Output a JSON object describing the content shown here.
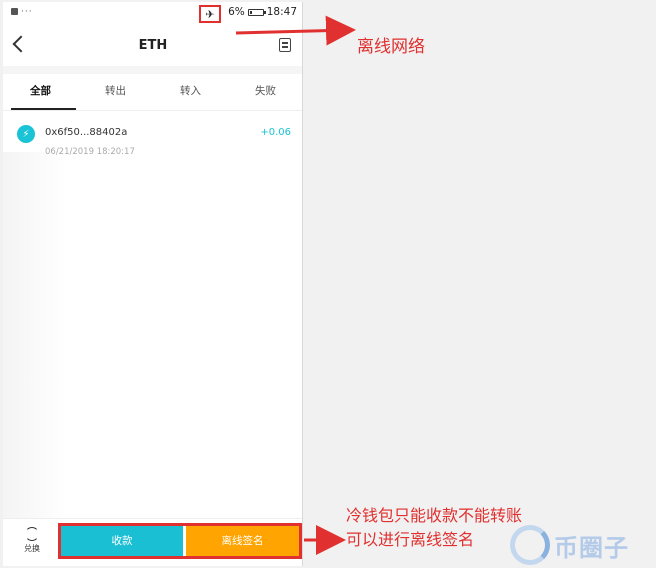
{
  "status_bar": {
    "left_dots": "···",
    "battery_percent": "6%",
    "time": "18:47",
    "airplane_icon": "airplane-icon"
  },
  "nav": {
    "title": "ETH",
    "back_icon": "chevron-left-icon",
    "records_icon": "document-icon"
  },
  "tabs": [
    {
      "label": "全部",
      "active": true
    },
    {
      "label": "转出",
      "active": false
    },
    {
      "label": "转入",
      "active": false
    },
    {
      "label": "失败",
      "active": false
    }
  ],
  "transactions": [
    {
      "hash": "0x6f50...88402a",
      "time": "06/21/2019 18:20:17",
      "amount": "+0.06",
      "icon": "lightning-icon"
    }
  ],
  "bottom_bar": {
    "exchange_label": "兑换",
    "receive_label": "收款",
    "offline_sign_label": "离线签名"
  },
  "annotations": {
    "offline_network": "离线网络",
    "cold_wallet_line1": "冷钱包只能收款不能转账",
    "cold_wallet_line2": "可以进行离线签名"
  },
  "watermark": {
    "text": "币圈子"
  },
  "colors": {
    "accent_cyan": "#1bbfd4",
    "accent_orange": "#ffa400",
    "annotation_red": "#e0302f"
  }
}
